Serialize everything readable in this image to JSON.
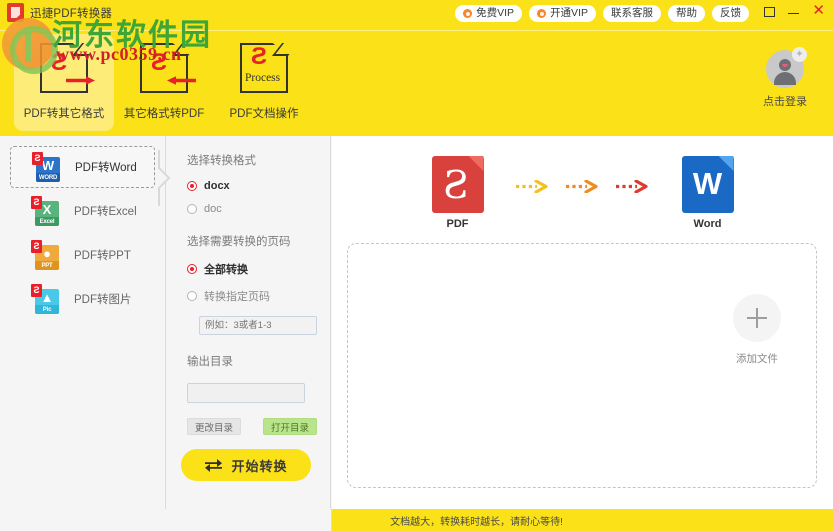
{
  "window": {
    "title": "迅捷PDF转换器",
    "app_icon": "pdf-app-icon",
    "maximize_icon": "maximize-icon",
    "minimize_icon": "minimize-icon",
    "close_icon": "close-icon"
  },
  "watermark": {
    "main": "河东软件园",
    "sub": "www.pc0359.cn",
    "main_color": "#3fa535",
    "sub_color": "#cf2127"
  },
  "topnav": {
    "items": [
      {
        "label": "免费VIP",
        "has_icon": true,
        "icon": "vip-badge-icon"
      },
      {
        "label": "开通VIP",
        "has_icon": true,
        "icon": "vip-badge-icon"
      },
      {
        "label": "联系客服",
        "has_icon": false,
        "icon": ""
      },
      {
        "label": "帮助",
        "has_icon": false,
        "icon": ""
      },
      {
        "label": "反馈",
        "has_icon": false,
        "icon": ""
      }
    ]
  },
  "tabs": [
    {
      "label": "PDF转其它格式",
      "icon": "pdf-to-other-icon",
      "active": true
    },
    {
      "label": "其它格式转PDF",
      "icon": "other-to-pdf-icon",
      "active": false
    },
    {
      "label": "PDF文档操作",
      "icon": "pdf-process-icon",
      "badge": "Process",
      "active": false
    }
  ],
  "account": {
    "label": "点击登录",
    "icon": "user-avatar-icon",
    "badge_icon": "star-badge-icon"
  },
  "sidebar": {
    "items": [
      {
        "label": "PDF转Word",
        "icon": "word-file-icon",
        "badge": "WORD",
        "letter": "W",
        "color": "#2b74c8",
        "cap": "#1f5fae",
        "active": true
      },
      {
        "label": "PDF转Excel",
        "icon": "excel-file-icon",
        "badge": "Excel",
        "letter": "X",
        "color": "#58b47c",
        "cap": "#3d9a61",
        "active": false
      },
      {
        "label": "PDF转PPT",
        "icon": "ppt-file-icon",
        "badge": "PPT",
        "letter": "P",
        "color": "#efa93c",
        "cap": "#e0941f",
        "active": false
      },
      {
        "label": "PDF转图片",
        "icon": "image-file-icon",
        "badge": "Pic",
        "letter": "I",
        "color": "#49c8e8",
        "cap": "#2fb6d9",
        "active": false
      }
    ],
    "collapse_icon": "chevron-right-icon"
  },
  "settings": {
    "format_section_title": "选择转换格式",
    "format_options": [
      {
        "label": "docx",
        "checked": true
      },
      {
        "label": "doc",
        "checked": false
      }
    ],
    "pages_section_title": "选择需要转换的页码",
    "page_options": [
      {
        "label": "全部转换",
        "checked": true
      },
      {
        "label": "转换指定页码",
        "checked": false
      }
    ],
    "page_range_value": "",
    "page_range_placeholder": "例如：3或者1-3",
    "output_section_title": "输出目录",
    "output_value": "",
    "output_placeholder": "",
    "change_dir_label": "更改目录",
    "open_dir_label": "打开目录",
    "convert_label": "开始转换",
    "convert_icon": "swap-arrows-icon"
  },
  "main": {
    "flow": {
      "source": {
        "label": "PDF",
        "icon": "pdf-document-icon"
      },
      "target": {
        "label": "Word",
        "icon": "word-document-icon"
      },
      "arrows": [
        {
          "icon": "dotted-arrow-icon",
          "color": "#f4c01c"
        },
        {
          "icon": "dotted-arrow-icon",
          "color": "#ef8b1f"
        },
        {
          "icon": "dotted-arrow-icon",
          "color": "#df3a2b"
        }
      ]
    },
    "dropzone": {
      "add_label": "添加文件",
      "add_icon": "plus-circle-icon"
    }
  },
  "statusbar": {
    "message": "文档越大，转换耗时越长，请耐心等待!"
  },
  "colors": {
    "brand_yellow": "#fbe117",
    "accent_red": "#e8202a",
    "panel_bg": "#f5f5f5"
  }
}
